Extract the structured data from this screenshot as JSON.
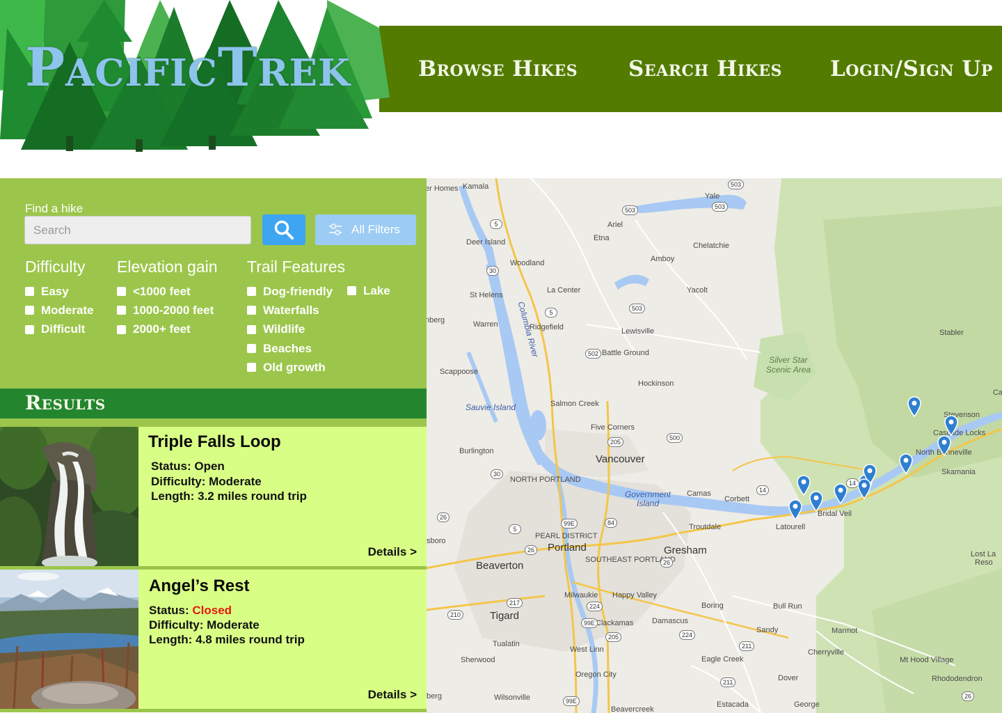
{
  "logo": {
    "text": "PacificTrek"
  },
  "nav": {
    "browse": "Browse Hikes",
    "search": "Search Hikes",
    "login": "Login/Sign Up"
  },
  "colors": {
    "nav_bg": "#527b00",
    "filter_bg": "#9cc64b",
    "results_bg": "#23862f",
    "card_bg": "#d9fe86",
    "search_button": "#3ea5f3",
    "filters_button": "#9ccbf3",
    "closed": "#e21a0c"
  },
  "search": {
    "label": "Find a hike",
    "placeholder": "Search",
    "search_icon": "magnifier-icon",
    "filters_label": "All Filters",
    "filters_icon": "sliders-icon"
  },
  "filters": {
    "difficulty": {
      "heading": "Difficulty",
      "options": [
        "Easy",
        "Moderate",
        "Difficult"
      ]
    },
    "elevation": {
      "heading": "Elevation gain",
      "options": [
        "<1000 feet",
        "1000-2000 feet",
        "2000+ feet"
      ]
    },
    "features": {
      "heading": "Trail Features",
      "options": [
        "Dog-friendly",
        "Waterfalls",
        "Wildlife",
        "Beaches",
        "Old growth",
        "Lake"
      ]
    }
  },
  "results": {
    "title": "Results",
    "cards": [
      {
        "title": "Triple Falls Loop",
        "status_label": "Status:",
        "status": "Open",
        "difficulty_label": "Difficulty:",
        "difficulty": "Moderate",
        "length_label": "Length:",
        "length": "3.2 miles round trip",
        "details": "Details >"
      },
      {
        "title": "Angel’s Rest",
        "status_label": "Status:",
        "status": "Closed",
        "difficulty_label": "Difficulty:",
        "difficulty": "Moderate",
        "length_label": "Length:",
        "length": "4.8 miles round trip",
        "details": "Details >"
      }
    ]
  },
  "map": {
    "cities": [
      "Vancouver",
      "Portland",
      "Gresham",
      "Beaverton",
      "Tigard"
    ],
    "towns": [
      "er Homes",
      "Kamala",
      "Yale",
      "Ariel",
      "Etna",
      "Chelatchie",
      "Deer Island",
      "Amboy",
      "Woodland",
      "La Center",
      "Yacolt",
      "St Helens",
      "Ridgefield",
      "Warren",
      "nberg",
      "Lewisville",
      "Battle Ground",
      "Stabler",
      "Scappoose",
      "Hockinson",
      "Salmon Creek",
      "Carso",
      "Stevenson",
      "Cascade Locks",
      "North Bonneville",
      "Skamania",
      "Five Corners",
      "Burlington",
      "NORTH PORTLAND",
      "Camas",
      "Corbett",
      "Troutdale",
      "Latourell",
      "Bridal Veil",
      "PEARL DISTRICT",
      "SOUTHEAST PORTLAND",
      "sboro",
      "Lost La",
      "Reso",
      "Milwaukie",
      "Happy Valley",
      "Boring",
      "Bull Run",
      "Clackamas",
      "Damascus",
      "Sandy",
      "Marmot",
      "Tualatin",
      "West Linn",
      "Cherryville",
      "Mt Hood Village",
      "Sherwood",
      "Eagle Creek",
      "Rhododendron",
      "Oregon City",
      "Dover",
      "Wilsonville",
      "Estacada",
      "George",
      "Beavercreek",
      "berg"
    ],
    "areas": [
      "Silver Star Scenic Area"
    ],
    "water": [
      "Columbia River",
      "Sauvie Island",
      "Government Island"
    ],
    "markers": [
      "trail-marker",
      "trail-marker",
      "trail-marker",
      "trail-marker",
      "trail-marker",
      "trail-marker",
      "trail-marker",
      "trail-marker",
      "trail-marker",
      "trail-marker",
      "trail-marker"
    ],
    "shields": [
      "503",
      "503",
      "503",
      "503",
      "5",
      "5",
      "5",
      "30",
      "30",
      "502",
      "500",
      "205",
      "205",
      "14",
      "14",
      "84",
      "99E",
      "99E",
      "99E",
      "26",
      "26",
      "26",
      "217",
      "210",
      "224",
      "224",
      "211",
      "211",
      "26"
    ]
  }
}
